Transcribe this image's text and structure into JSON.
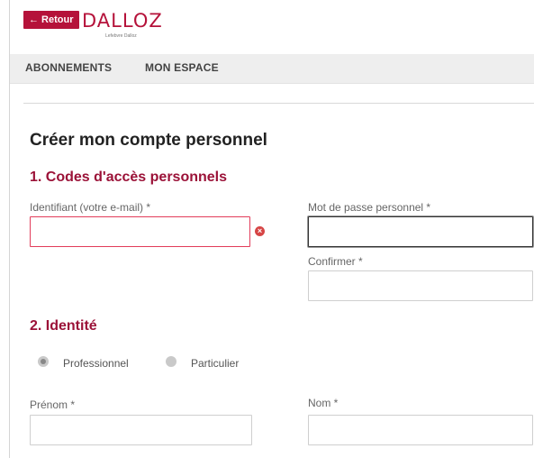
{
  "header": {
    "back_label": "← Retour",
    "logo_text": "DALLOZ",
    "logo_subtitle": "Lefebvre Dalloz"
  },
  "nav": {
    "items": [
      {
        "label": "ABONNEMENTS"
      },
      {
        "label": "MON ESPACE"
      }
    ]
  },
  "page": {
    "title": "Créer mon compte personnel"
  },
  "section1": {
    "title": "1. Codes d'accès personnels",
    "identifiant_label": "Identifiant (votre e-mail) *",
    "identifiant_value": "",
    "password_label": "Mot de passe personnel *",
    "password_value": "",
    "confirm_label": "Confirmer *",
    "confirm_value": ""
  },
  "section2": {
    "title": "2. Identité",
    "radio_professionnel": "Professionnel",
    "radio_particulier": "Particulier",
    "prenom_label": "Prénom *",
    "prenom_value": "",
    "nom_label": "Nom *",
    "nom_value": ""
  },
  "colors": {
    "brand": "#b5123a",
    "section_title": "#9b1238",
    "error": "#e23d5a"
  },
  "icons": {
    "error_icon": "error-circle-icon"
  }
}
